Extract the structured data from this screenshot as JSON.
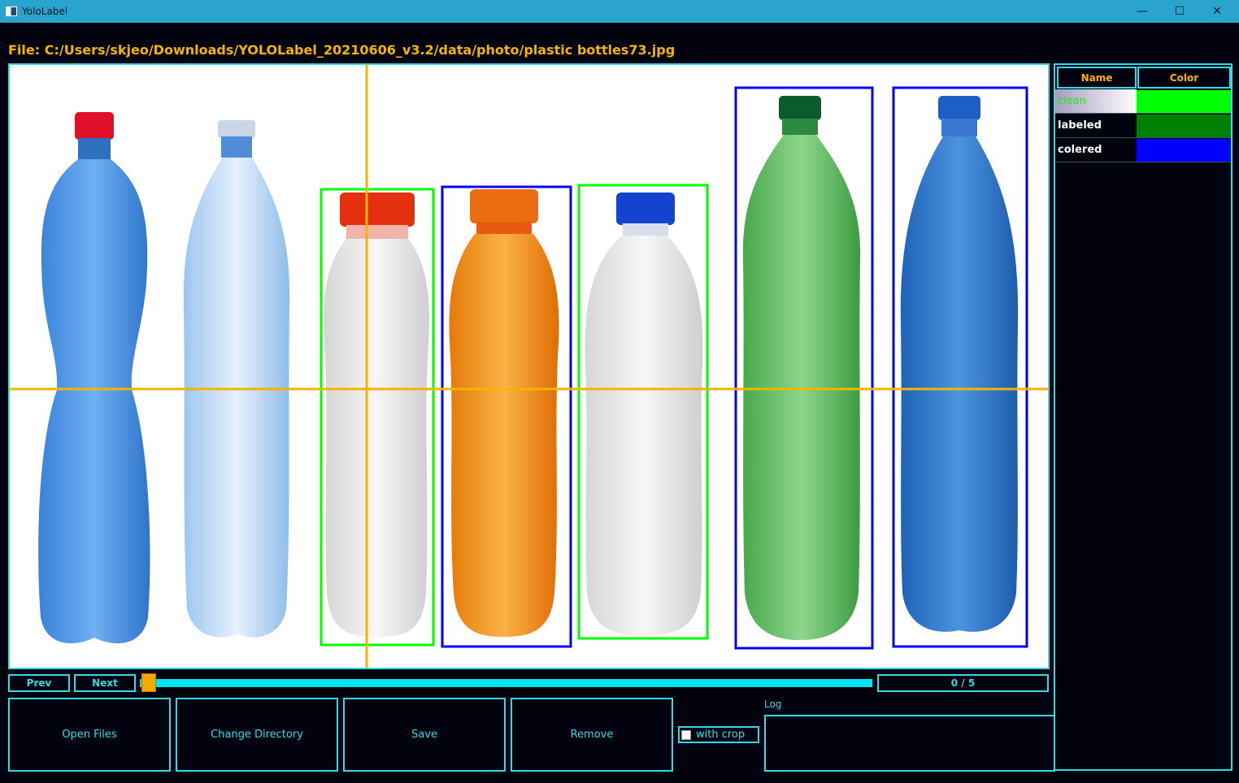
{
  "window": {
    "title": "YoloLabel"
  },
  "file_label": "File: C:/Users/skjeo/Downloads/YOLOLabel_20210606_v3.2/data/photo/plastic bottles73.jpg",
  "class_table": {
    "headers": {
      "name": "Name",
      "color": "Color"
    },
    "rows": [
      {
        "name": "clean",
        "color": "#00ff00",
        "selected": true
      },
      {
        "name": "labeled",
        "color": "#008000",
        "selected": false
      },
      {
        "name": "colered",
        "color": "#0000ff",
        "selected": false
      }
    ]
  },
  "nav": {
    "prev": "Prev",
    "next": "Next",
    "counter": "0 / 5",
    "progress": 0
  },
  "buttons": {
    "open_files": "Open Files",
    "change_directory": "Change Directory",
    "save": "Save",
    "remove": "Remove",
    "with_crop": "with crop"
  },
  "log": {
    "label": "Log",
    "text": ""
  },
  "colors": {
    "accent": "#33d9e8",
    "file_text": "#f4b400",
    "crosshair": "#f4b400",
    "titlebar": "#2aa3cf"
  }
}
